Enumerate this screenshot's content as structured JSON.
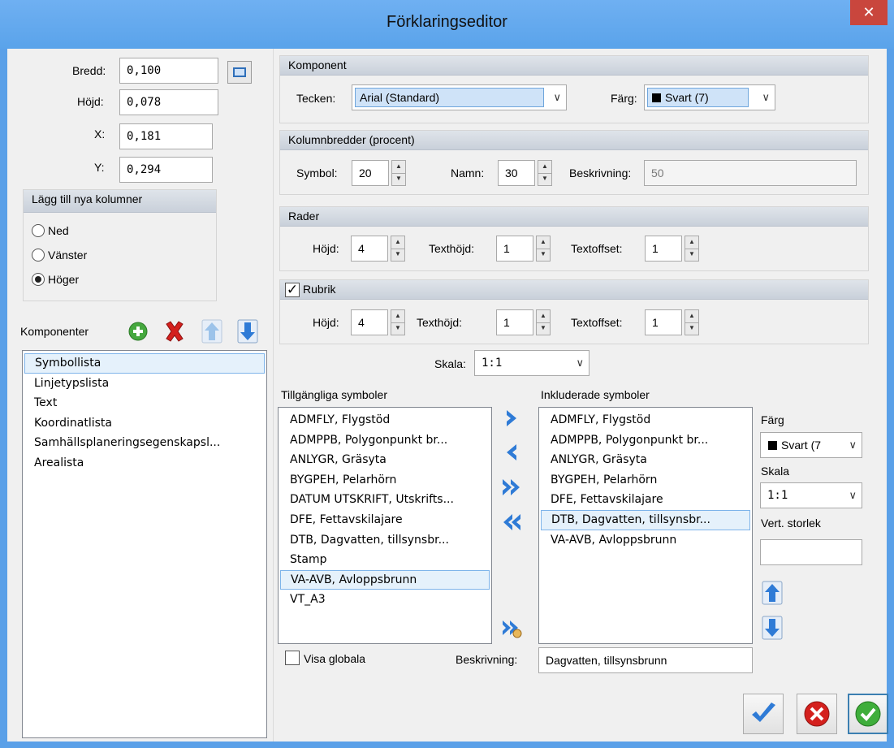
{
  "window": {
    "title": "Förklaringseditor",
    "close_icon": "close-icon"
  },
  "size": {
    "width_label": "Bredd:",
    "width_value": "0,100",
    "height_label": "Höjd:",
    "height_value": "0,078",
    "x_label": "X:",
    "x_value": "0,181",
    "y_label": "Y:",
    "y_value": "0,294"
  },
  "add_columns": {
    "title": "Lägg till nya kolumner",
    "options": [
      "Ned",
      "Vänster",
      "Höger"
    ],
    "selected": "Höger"
  },
  "components": {
    "label": "Komponenter",
    "items": [
      "Symbollista",
      "Linjetypslista",
      "Text",
      "Koordinatlista",
      "Samhällsplaneringsegenskapsl...",
      "Arealista"
    ],
    "selected": "Symbollista"
  },
  "komponent": {
    "title": "Komponent",
    "font_label": "Tecken:",
    "font_value": "Arial (Standard)",
    "color_label": "Färg:",
    "color_value": "Svart (7)"
  },
  "column_widths": {
    "title": "Kolumnbredder (procent)",
    "symbol_label": "Symbol:",
    "symbol_value": "20",
    "name_label": "Namn:",
    "name_value": "30",
    "desc_label": "Beskrivning:",
    "desc_value": "50"
  },
  "rows": {
    "title": "Rader",
    "height_label": "Höjd:",
    "height_value": "4",
    "text_height_label": "Texthöjd:",
    "text_height_value": "1",
    "text_offset_label": "Textoffset:",
    "text_offset_value": "1"
  },
  "header": {
    "title": "Rubrik",
    "checked": true,
    "height_label": "Höjd:",
    "height_value": "4",
    "text_height_label": "Texthöjd:",
    "text_height_value": "1",
    "text_offset_label": "Textoffset:",
    "text_offset_value": "1"
  },
  "scale": {
    "label": "Skala:",
    "value": "1:1"
  },
  "available": {
    "title": "Tillgängliga symboler",
    "items": [
      "ADMFLY, Flygstöd",
      "ADMPPB, Polygonpunkt br...",
      "ANLYGR, Gräsyta",
      "BYGPEH, Pelarhörn",
      "DATUM UTSKRIFT, Utskrifts...",
      "DFE, Fettavskilajare",
      "DTB, Dagvatten, tillsynsbr...",
      "Stamp",
      "VA-AVB, Avloppsbrunn",
      "VT_A3"
    ],
    "selected": "VA-AVB, Avloppsbrunn"
  },
  "included": {
    "title": "Inkluderade symboler",
    "items": [
      "ADMFLY, Flygstöd",
      "ADMPPB, Polygonpunkt br...",
      "ANLYGR, Gräsyta",
      "BYGPEH, Pelarhörn",
      "DFE, Fettavskilajare",
      "DTB, Dagvatten, tillsynsbr...",
      "VA-AVB, Avloppsbrunn"
    ],
    "selected": "DTB, Dagvatten, tillsynsbr..."
  },
  "symbol_props": {
    "color_label": "Färg",
    "color_value": "Svart (7",
    "scale_label": "Skala",
    "scale_value": "1:1",
    "vert_size_label": "Vert. storlek",
    "vert_size_value": ""
  },
  "show_global": {
    "label": "Visa globala",
    "checked": false
  },
  "description": {
    "label": "Beskrivning:",
    "value": "Dagvatten, tillsynsbrunn"
  },
  "colors": {
    "titlebar": "#5aa3ea",
    "close": "#c9463d",
    "selection": "#cfe3f8",
    "accent_blue": "#2f7bd6",
    "red": "#d4201d",
    "green": "#3fae3b"
  }
}
